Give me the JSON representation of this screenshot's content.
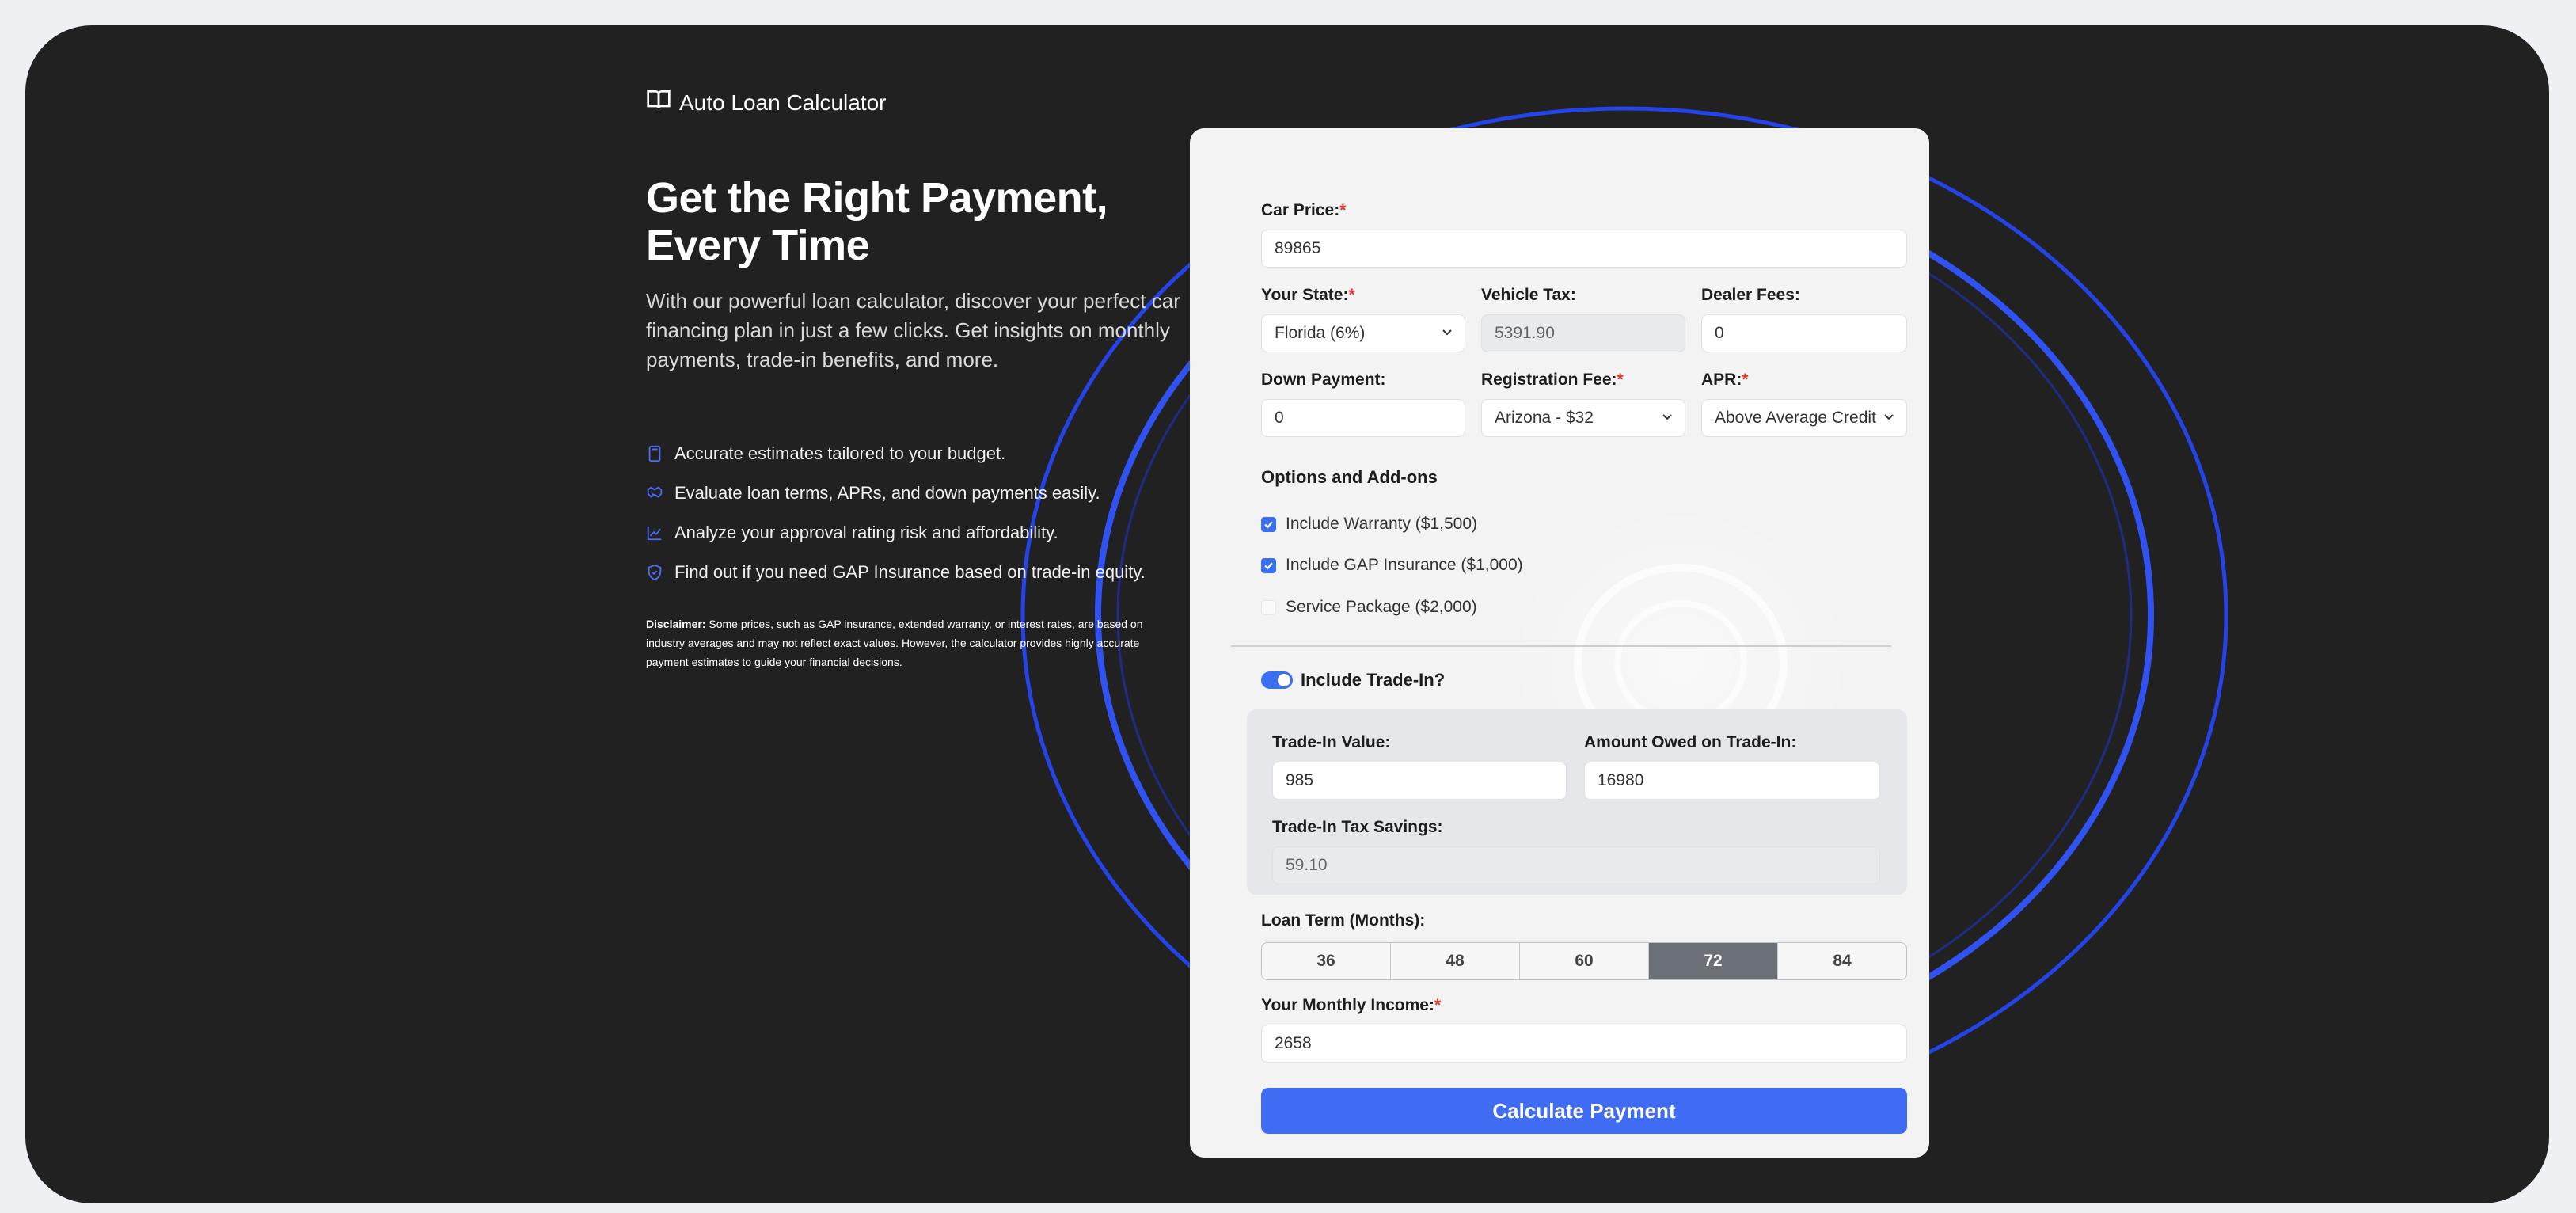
{
  "brand": {
    "icon": "open-book-icon",
    "title": "Auto Loan Calculator"
  },
  "hero": {
    "title_line1": "Get the Right Payment,",
    "title_line2": "Every Time",
    "subtitle": "With our powerful loan calculator, discover your perfect car financing plan in just a few clicks. Get insights on monthly payments, trade-in benefits, and more."
  },
  "features": [
    {
      "icon": "calculator-icon",
      "text": "Accurate estimates tailored to your budget."
    },
    {
      "icon": "handshake-icon",
      "text": "Evaluate loan terms, APRs, and down payments easily."
    },
    {
      "icon": "trend-chart-icon",
      "text": "Analyze your approval rating risk and affordability."
    },
    {
      "icon": "shield-check-icon",
      "text": "Find out if you need GAP Insurance based on trade-in equity."
    }
  ],
  "disclaimer": {
    "label": "Disclaimer:",
    "text": "Some prices, such as GAP insurance, extended warranty, or interest rates, are based on industry averages and may not reflect exact values. However, the calculator provides highly accurate payment estimates to guide your financial decisions."
  },
  "form": {
    "required_mark": "*",
    "car_price": {
      "label": "Car Price:",
      "value": "89865"
    },
    "state": {
      "label": "Your State:",
      "value": "Florida (6%)"
    },
    "vehicle_tax": {
      "label": "Vehicle Tax:",
      "value": "5391.90"
    },
    "dealer_fees": {
      "label": "Dealer Fees:",
      "value": "0"
    },
    "down_payment": {
      "label": "Down Payment:",
      "value": "0"
    },
    "registration_fee": {
      "label": "Registration Fee:",
      "value": "Arizona - $32"
    },
    "apr": {
      "label": "APR:",
      "value": "Above Average Credit"
    },
    "options_title": "Options and Add-ons",
    "options": [
      {
        "label": "Include Warranty ($1,500)",
        "checked": true
      },
      {
        "label": "Include GAP Insurance ($1,000)",
        "checked": true
      },
      {
        "label": "Service Package ($2,000)",
        "checked": false
      }
    ],
    "trade_in_toggle": {
      "label": "Include Trade-In?",
      "on": true
    },
    "trade_in_value": {
      "label": "Trade-In Value:",
      "value": "985"
    },
    "amount_owed": {
      "label": "Amount Owed on Trade-In:",
      "value": "16980"
    },
    "trade_in_tax_savings": {
      "label": "Trade-In Tax Savings:",
      "value": "59.10"
    },
    "loan_term": {
      "label": "Loan Term (Months):",
      "options": [
        "36",
        "48",
        "60",
        "72",
        "84"
      ],
      "selected": "72"
    },
    "monthly_income": {
      "label": "Your Monthly Income:",
      "value": "2658"
    },
    "submit_label": "Calculate Payment"
  },
  "colors": {
    "accent": "#3f6cf3",
    "background": "#212121",
    "card": "#f3f3f4",
    "required": "#e0312b"
  }
}
